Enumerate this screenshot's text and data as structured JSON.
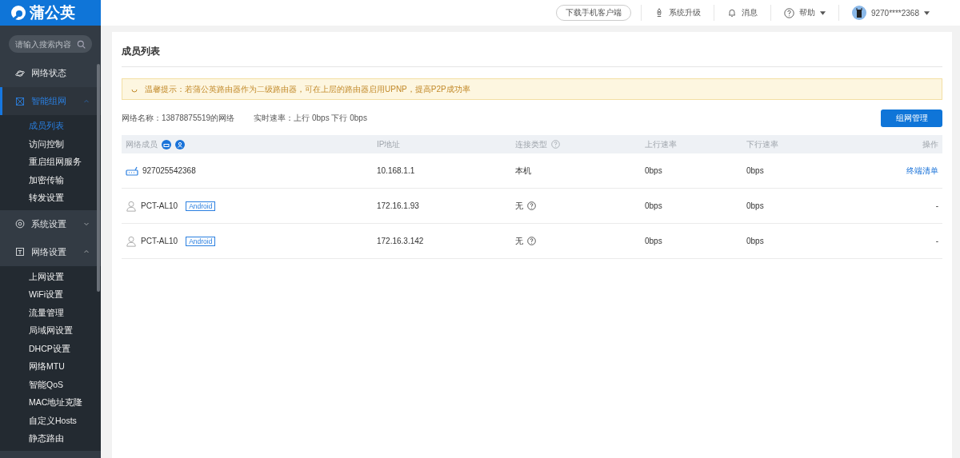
{
  "logo": {
    "text": "蒲公英"
  },
  "header": {
    "download_button": "下载手机客户端",
    "actions": [
      {
        "kind": "upgrade",
        "label": "系统升级",
        "caret": false
      },
      {
        "kind": "bell",
        "label": "消息",
        "caret": false
      },
      {
        "kind": "help",
        "label": "帮助",
        "caret": true
      }
    ],
    "user": {
      "name": "9270****2368"
    }
  },
  "sidebar": {
    "search": {
      "placeholder": "请输入搜索内容"
    },
    "groups": [
      {
        "kind": "status",
        "label": "网络状态",
        "selected": false
      },
      {
        "kind": "mesh",
        "label": "智能组网",
        "selected": true,
        "expanded": true,
        "children": [
          {
            "label": "成员列表",
            "selected": true
          },
          {
            "label": "访问控制",
            "selected": false
          },
          {
            "label": "重启组网服务",
            "selected": false
          },
          {
            "label": "加密传输",
            "selected": false
          },
          {
            "label": "转发设置",
            "selected": false
          }
        ]
      },
      {
        "kind": "system",
        "label": "系统设置",
        "selected": false,
        "expanded": false
      },
      {
        "kind": "network",
        "label": "网络设置",
        "selected": false,
        "expanded": true,
        "children": [
          {
            "label": "上网设置",
            "selected": false
          },
          {
            "label": "WiFi设置",
            "selected": false
          },
          {
            "label": "流量管理",
            "selected": false
          },
          {
            "label": "局域网设置",
            "selected": false
          },
          {
            "label": "DHCP设置",
            "selected": false
          },
          {
            "label": "网络MTU",
            "selected": false
          },
          {
            "label": "智能QoS",
            "selected": false
          },
          {
            "label": "MAC地址克隆",
            "selected": false
          },
          {
            "label": "自定义Hosts",
            "selected": false
          },
          {
            "label": "静态路由",
            "selected": false
          }
        ]
      }
    ]
  },
  "page": {
    "title": "成员列表",
    "notice": "温馨提示：若蒲公英路由器作为二级路由器，可在上层的路由器启用UPNP，提高P2P成功率",
    "network_name": "网络名称：13878875519的网络",
    "speed": "实时速率：上行 0bps 下行 0bps",
    "manage_button": "组网管理"
  },
  "table": {
    "columns": [
      "网络成员",
      "IP地址",
      "连接类型",
      "上行速率",
      "下行速率",
      "操作"
    ],
    "rows": [
      {
        "kind": "router",
        "name": "927025542368",
        "ip": "10.168.1.1",
        "type": "本机",
        "type_help": false,
        "up": "0bps",
        "down": "0bps",
        "action": "终端清单",
        "link": true
      },
      {
        "kind": "user",
        "name": "PCT-AL10",
        "tag": "Android",
        "ip": "172.16.1.93",
        "type": "无",
        "type_help": true,
        "up": "0bps",
        "down": "0bps",
        "action": "-",
        "link": false
      },
      {
        "kind": "user",
        "name": "PCT-AL10",
        "tag": "Android",
        "ip": "172.16.3.142",
        "type": "无",
        "type_help": true,
        "up": "0bps",
        "down": "0bps",
        "action": "-",
        "link": false
      }
    ]
  }
}
